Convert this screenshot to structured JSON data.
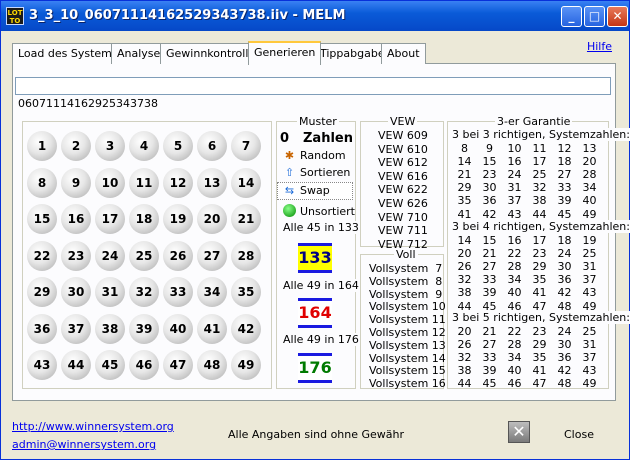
{
  "window": {
    "title": "3_3_10_06071114162529343738.iiv - MELM",
    "app_icon_text": "LOTTO"
  },
  "tabs": [
    {
      "label": "Load des Systems"
    },
    {
      "label": "Analyse"
    },
    {
      "label": "Gewinnkontrolle"
    },
    {
      "label": "Generieren"
    },
    {
      "label": "Tippabgabe"
    },
    {
      "label": "About"
    }
  ],
  "active_tab": "Generieren",
  "help_link": "Hilfe",
  "input": {
    "value": ""
  },
  "id_label": "06071114162925343738",
  "balls": [
    "1",
    "2",
    "3",
    "4",
    "5",
    "6",
    "7",
    "8",
    "9",
    "10",
    "11",
    "12",
    "13",
    "14",
    "15",
    "16",
    "17",
    "18",
    "19",
    "20",
    "21",
    "22",
    "23",
    "24",
    "25",
    "26",
    "27",
    "28",
    "29",
    "30",
    "31",
    "32",
    "33",
    "34",
    "35",
    "36",
    "37",
    "38",
    "39",
    "40",
    "41",
    "42",
    "43",
    "44",
    "45",
    "46",
    "47",
    "48",
    "49"
  ],
  "muster": {
    "title": "Muster",
    "zahlen_count": "0",
    "zahlen_label": "Zahlen",
    "random": "Random",
    "sortieren": "Sortieren",
    "swap": "Swap",
    "unsortiert": "Unsortiert",
    "group1_title": "Alle 45 in 133",
    "group1_value": "133",
    "group2_title": "Alle 49 in 164",
    "group2_value": "164",
    "group3_title": "Alle 49 in 176",
    "group3_value": "176"
  },
  "vew": {
    "title": "VEW",
    "items": [
      "VEW 609",
      "VEW 610",
      "VEW 612",
      "VEW 616",
      "VEW 622",
      "VEW 626",
      "VEW 710",
      "VEW 711",
      "VEW 712"
    ]
  },
  "voll": {
    "title": "Voll",
    "items": [
      "Vollsystem  7",
      "Vollsystem  8",
      "Vollsystem  9",
      "Vollsystem 10",
      "Vollsystem 11",
      "Vollsystem 12",
      "Vollsystem 13",
      "Vollsystem 14",
      "Vollsystem 15",
      "Vollsystem 16"
    ]
  },
  "garantie": {
    "title": "3-er Garantie",
    "section1_title": "3 bei 3 richtigen, Systemzahlen:",
    "section1_rows": [
      [
        "8",
        "9",
        "10",
        "11",
        "12",
        "13"
      ],
      [
        "14",
        "15",
        "16",
        "17",
        "18",
        "20"
      ],
      [
        "21",
        "23",
        "24",
        "25",
        "27",
        "28"
      ],
      [
        "29",
        "30",
        "31",
        "32",
        "33",
        "34"
      ],
      [
        "35",
        "36",
        "37",
        "38",
        "39",
        "40"
      ],
      [
        "41",
        "42",
        "43",
        "44",
        "45",
        "49"
      ]
    ],
    "section2_title": "3 bei 4 richtigen, Systemzahlen:",
    "section2_rows": [
      [
        "14",
        "15",
        "16",
        "17",
        "18",
        "19"
      ],
      [
        "20",
        "21",
        "22",
        "23",
        "24",
        "25"
      ],
      [
        "26",
        "27",
        "28",
        "29",
        "30",
        "31"
      ],
      [
        "32",
        "33",
        "34",
        "35",
        "36",
        "37"
      ],
      [
        "38",
        "39",
        "40",
        "41",
        "42",
        "43"
      ],
      [
        "44",
        "45",
        "46",
        "47",
        "48",
        "49"
      ]
    ],
    "section3_title": "3 bei 5 richtigen, Systemzahlen:",
    "section3_rows": [
      [
        "20",
        "21",
        "22",
        "23",
        "24",
        "25"
      ],
      [
        "26",
        "27",
        "28",
        "29",
        "30",
        "31"
      ],
      [
        "32",
        "33",
        "34",
        "35",
        "36",
        "37"
      ],
      [
        "38",
        "39",
        "40",
        "41",
        "42",
        "43"
      ],
      [
        "44",
        "45",
        "46",
        "47",
        "48",
        "49"
      ]
    ]
  },
  "footer": {
    "website": "http://www.winnersystem.org",
    "email": "admin@winnersystem.org",
    "disclaimer": "Alle Angaben sind ohne Gewähr",
    "close_label": "Close"
  }
}
